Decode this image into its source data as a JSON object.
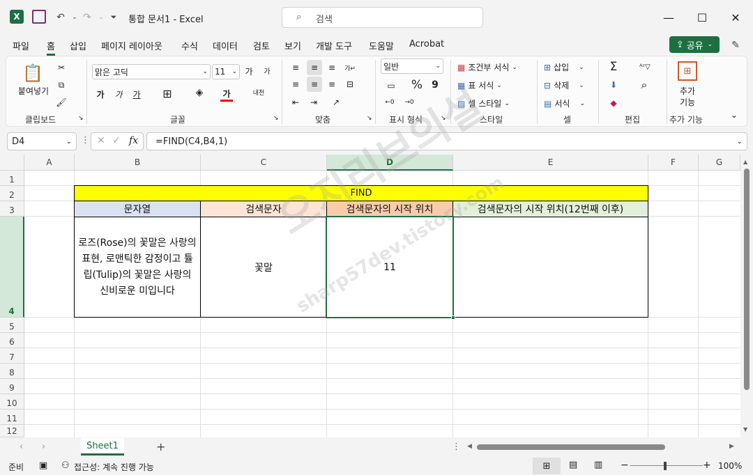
{
  "window": {
    "title": "통합 문서1  -  Excel",
    "search_placeholder": "검색",
    "minimize": "—",
    "maximize": "☐",
    "close": "✕"
  },
  "menu": {
    "items": [
      "파일",
      "홈",
      "삽입",
      "페이지 레이아웃",
      "수식",
      "데이터",
      "검토",
      "보기",
      "개발 도구",
      "도움말",
      "Acrobat"
    ],
    "share_label": "공유"
  },
  "ribbon": {
    "clipboard": {
      "paste_label": "붙여넣기",
      "group": "클립보드"
    },
    "font": {
      "name": "맑은 고딕",
      "size": "11",
      "bold": "가",
      "italic": "가",
      "underline": "가",
      "color_a": "가",
      "increase": "가",
      "decrease": "가",
      "group": "글꼴"
    },
    "alignment": {
      "group": "맞춤"
    },
    "number": {
      "format": "일반",
      "group": "표시 형식",
      "percent": "%",
      "comma": "9"
    },
    "styles": {
      "conditional": "조건부 서식",
      "table": "표 서식",
      "cell_styles": "셀 스타일",
      "group": "스타일"
    },
    "cells": {
      "insert": "삽입",
      "delete": "삭제",
      "format": "서식",
      "group": "셀"
    },
    "editing": {
      "group": "편집",
      "sum": "Σ"
    },
    "addins": {
      "label1": "추가",
      "label2": "기능",
      "group": "추가 기능"
    }
  },
  "formula_bar": {
    "name_box": "D4",
    "fx": "fx",
    "formula": "=FIND(C4,B4,1)"
  },
  "grid": {
    "columns": [
      "A",
      "B",
      "C",
      "D",
      "E",
      "F",
      "G"
    ],
    "rows": [
      "1",
      "2",
      "3",
      "4",
      "5",
      "6",
      "7",
      "8",
      "9",
      "10",
      "11",
      "12"
    ],
    "selected_column": "D",
    "selected_row": "4",
    "title_cell": "FIND",
    "header_b": "문자열",
    "header_c": "검색문자",
    "header_d": "검색문자의 시작 위치",
    "header_e": "검색문자의 시작 위치(12번째 이후)",
    "b4": "로즈(Rose)의 꽃말은 사랑의 표현, 로맨틱한 감정이고 튤립(Tulip)의 꽃말은 사랑의 신비로운 미입니다",
    "c4": "꽃말",
    "d4": "11",
    "e4": ""
  },
  "watermark": {
    "line1": "오지리브의설",
    "line2": "sharp57dev.tistory.com"
  },
  "sheets": {
    "tabs": [
      "Sheet1"
    ],
    "add": "+"
  },
  "status": {
    "ready": "준비",
    "accessibility": "접근성: 계속 진행 가능",
    "zoom": "100%"
  },
  "colors": {
    "title_fill": "#ffff00",
    "header_b_fill": "#d9e1f2",
    "header_c_fill": "#fce4d6",
    "header_d_fill": "#f8cbad",
    "header_e_fill": "#e2efda",
    "accent": "#1d6f42"
  }
}
